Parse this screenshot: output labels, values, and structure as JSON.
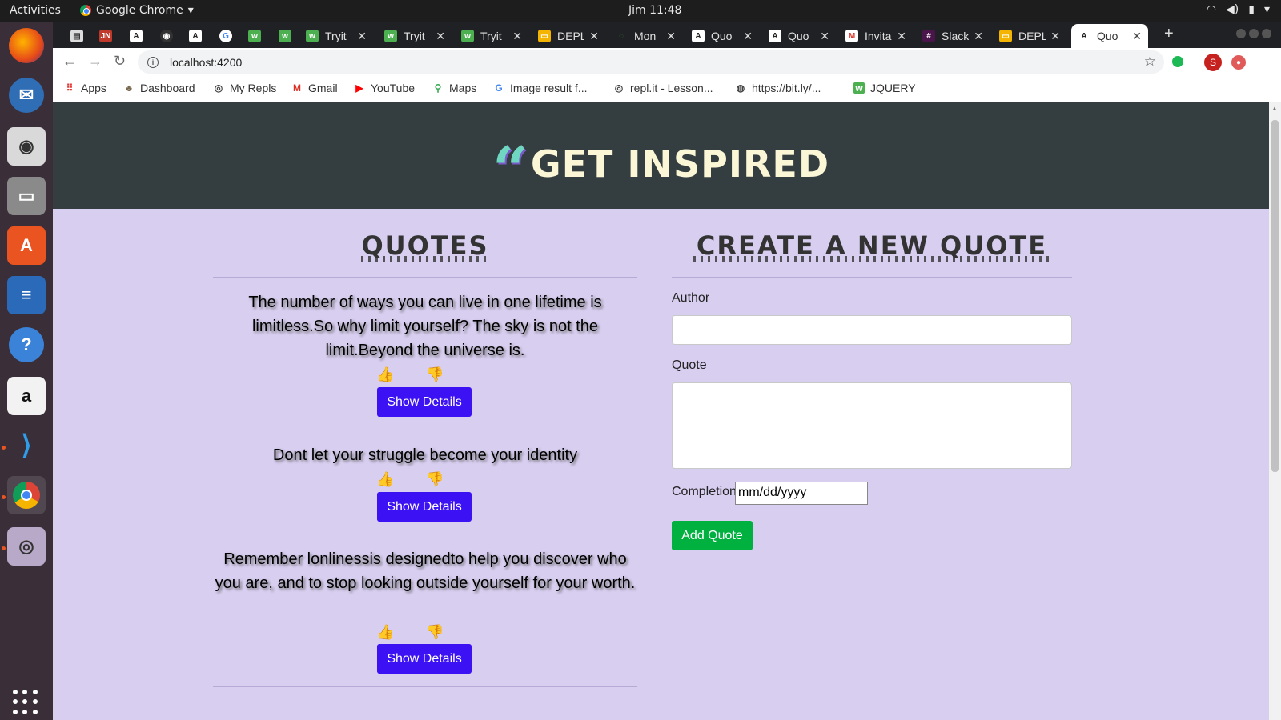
{
  "os": {
    "activities": "Activities",
    "app_name": "Google Chrome",
    "app_menu_arrow": "▾",
    "clock": "Jim 11:48"
  },
  "browser": {
    "tabs": [
      {
        "title": ""
      },
      {
        "title": ""
      },
      {
        "title": ""
      },
      {
        "title": ""
      },
      {
        "title": ""
      },
      {
        "title": ""
      },
      {
        "title": ""
      },
      {
        "title": ""
      },
      {
        "title": "Tryit"
      },
      {
        "title": "Tryit"
      },
      {
        "title": "Tryit"
      },
      {
        "title": "DEPL"
      },
      {
        "title": "Mon"
      },
      {
        "title": "Quo"
      },
      {
        "title": "Quo"
      },
      {
        "title": "Invita"
      },
      {
        "title": "Slack"
      },
      {
        "title": "DEPL"
      },
      {
        "title": "Quo"
      }
    ],
    "url": "localhost:4200",
    "avatar_letter": "S",
    "bookmarks": [
      {
        "label": "Apps"
      },
      {
        "label": "Dashboard"
      },
      {
        "label": "My Repls"
      },
      {
        "label": "Gmail"
      },
      {
        "label": "YouTube"
      },
      {
        "label": "Maps"
      },
      {
        "label": "Image result f..."
      },
      {
        "label": "repl.it - Lesson..."
      },
      {
        "label": "https://bit.ly/..."
      },
      {
        "label": "JQUERY"
      }
    ]
  },
  "page": {
    "hero_title": "GET INSPIRED",
    "quotes_heading": "QUOTES",
    "create_heading": "CREATE A NEW QUOTE",
    "quotes": [
      {
        "text": "The number of ways you can live in one lifetime is limitless.So why limit yourself? The sky is not the limit.Beyond the universe is.",
        "button": "Show Details"
      },
      {
        "text": "Dont let your struggle become your identity",
        "button": "Show Details"
      },
      {
        "text": "Remember lonlinessis designedto help you discover who you are, and to stop looking outside yourself for your worth.",
        "button": "Show Details"
      }
    ],
    "form": {
      "author_label": "Author",
      "author_value": "",
      "quote_label": "Quote",
      "quote_value": "",
      "completion_label": "Completion",
      "completion_placeholder": "mm/dd/yyyy",
      "submit_label": "Add Quote"
    }
  },
  "colors": {
    "hero_bg": "#343d3f",
    "page_bg": "#d8cef0",
    "details_button": "#3c12f5",
    "add_button": "#00b140",
    "upvote": "#5b1ef0",
    "downvote": "#e02020"
  }
}
